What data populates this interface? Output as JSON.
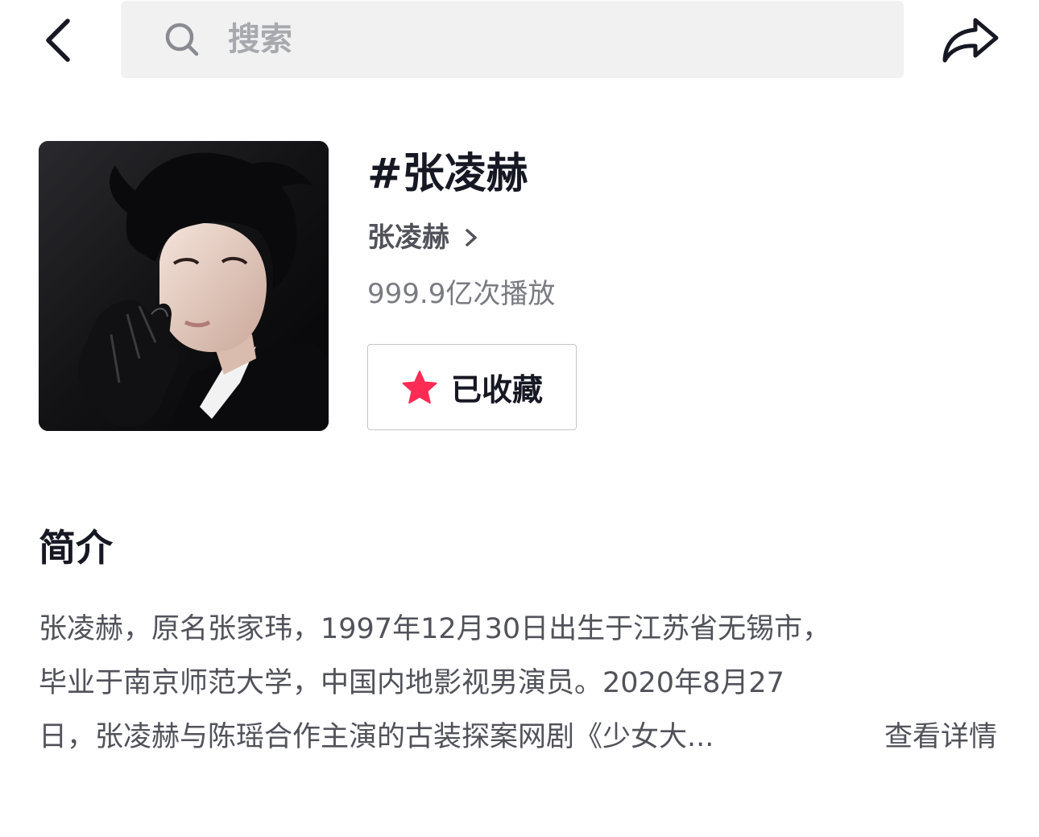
{
  "header": {
    "back_icon": "chevron-left-icon",
    "search_placeholder": "搜索",
    "search_icon": "search-icon",
    "share_icon": "share-icon"
  },
  "topic": {
    "title": "#张凌赫",
    "author_name": "张凌赫",
    "plays": "999.9亿次播放",
    "favorite_label": "已收藏",
    "favorite_icon": "star-icon",
    "favorite_color": "#fe2c55"
  },
  "intro": {
    "heading": "简介",
    "lines": [
      "张凌赫，原名张家玮，1997年12月30日出生于江苏省无锡市，",
      "毕业于南京师范大学，中国内地影视男演员。2020年8月27",
      "日，张凌赫与陈瑶合作主演的古装探案网剧《少女大..."
    ],
    "more_label": "查看详情"
  }
}
